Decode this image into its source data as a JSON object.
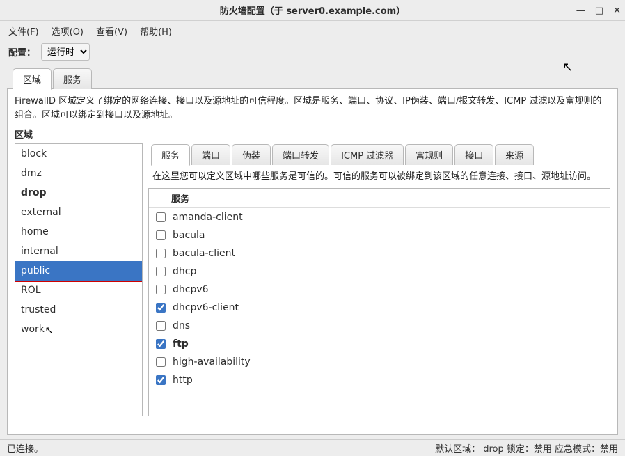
{
  "window": {
    "title": "防火墙配置（于  server0.example.com）",
    "min": "—",
    "max": "□",
    "close": "✕"
  },
  "menu": {
    "file": "文件(F)",
    "options": "选项(O)",
    "view": "查看(V)",
    "help": "帮助(H)"
  },
  "config": {
    "label": "配置：",
    "value": "运行时"
  },
  "maintabs": {
    "zone": "区域",
    "service": "服务"
  },
  "description": "FirewallD 区域定义了绑定的网络连接、接口以及源地址的可信程度。区域是服务、端口、协议、IP伪装、端口/报文转发、ICMP 过滤以及富规则的组合。区域可以绑定到接口以及源地址。",
  "zone": {
    "label": "区域",
    "items": [
      {
        "name": "block",
        "bold": false,
        "selected": false
      },
      {
        "name": "dmz",
        "bold": false,
        "selected": false
      },
      {
        "name": "drop",
        "bold": true,
        "selected": false
      },
      {
        "name": "external",
        "bold": false,
        "selected": false
      },
      {
        "name": "home",
        "bold": false,
        "selected": false
      },
      {
        "name": "internal",
        "bold": false,
        "selected": false
      },
      {
        "name": "public",
        "bold": false,
        "selected": true
      },
      {
        "name": "ROL",
        "bold": false,
        "selected": false
      },
      {
        "name": "trusted",
        "bold": false,
        "selected": false
      },
      {
        "name": "work",
        "bold": false,
        "selected": false
      }
    ]
  },
  "subtabs": {
    "services": "服务",
    "ports": "端口",
    "masq": "伪装",
    "portfwd": "端口转发",
    "icmp": "ICMP 过滤器",
    "rich": "富规则",
    "ifaces": "接口",
    "sources": "来源"
  },
  "subdesc": "在这里您可以定义区域中哪些服务是可信的。可信的服务可以被绑定到该区域的任意连接、接口、源地址访问。",
  "svcheader": "服务",
  "services": [
    {
      "name": "amanda-client",
      "checked": false,
      "bold": false
    },
    {
      "name": "bacula",
      "checked": false,
      "bold": false
    },
    {
      "name": "bacula-client",
      "checked": false,
      "bold": false
    },
    {
      "name": "dhcp",
      "checked": false,
      "bold": false
    },
    {
      "name": "dhcpv6",
      "checked": false,
      "bold": false
    },
    {
      "name": "dhcpv6-client",
      "checked": true,
      "bold": false
    },
    {
      "name": "dns",
      "checked": false,
      "bold": false
    },
    {
      "name": "ftp",
      "checked": true,
      "bold": true
    },
    {
      "name": "high-availability",
      "checked": false,
      "bold": false
    },
    {
      "name": "http",
      "checked": true,
      "bold": false
    }
  ],
  "status": {
    "left": "已连接。",
    "right": "默认区域： drop  锁定：禁用  应急模式：禁用"
  }
}
